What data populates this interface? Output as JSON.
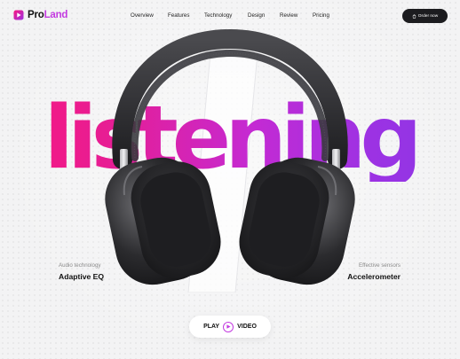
{
  "brand": {
    "name_prefix": "Pro",
    "name_suffix": "Land",
    "accent": "#c33be0",
    "logo_icon": "play-logo-icon"
  },
  "nav": {
    "links": [
      {
        "label": "Overview"
      },
      {
        "label": "Features"
      },
      {
        "label": "Technology"
      },
      {
        "label": "Design"
      },
      {
        "label": "Review"
      },
      {
        "label": "Pricing"
      }
    ]
  },
  "order_button": {
    "label": "Order now",
    "icon": "bag-icon"
  },
  "hero": {
    "word": "listening",
    "gradient": [
      "#f8167f",
      "#c42ad3",
      "#8b36e6"
    ],
    "image": "headphones-image"
  },
  "features": {
    "left": {
      "subtitle": "Audio technology",
      "title": "Adaptive EQ"
    },
    "right": {
      "subtitle": "Effective sensors",
      "title": "Accelerometer"
    }
  },
  "play_video": {
    "label_left": "PLAY",
    "label_right": "VIDEO",
    "icon": "play-icon"
  }
}
